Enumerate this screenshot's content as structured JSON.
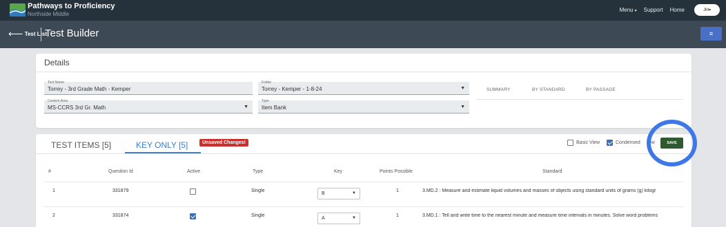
{
  "app": {
    "name": "Pathways to Proficiency",
    "school": "Northside Middle"
  },
  "topnav": {
    "menu": "Menu",
    "support": "Support",
    "home": "Home",
    "user_initials": "JM"
  },
  "subheader": {
    "back_label": "Test List",
    "title": "Test Builder",
    "menu_icon": "hamburger-icon"
  },
  "details": {
    "title": "Details",
    "test_name": {
      "label": "Test Name",
      "value": "Torrey - 3rd Grade Math - Kemper"
    },
    "folder": {
      "label": "Folder",
      "value": "Torrey - Kemper - 1-8-24"
    },
    "content_area": {
      "label": "Content Area",
      "value": "MS-CCRS 3rd Gr. Math"
    },
    "type": {
      "label": "Type",
      "value": "Item Bank"
    },
    "summary_tabs": [
      "SUMMARY",
      "BY STANDARD",
      "BY PASSAGE"
    ]
  },
  "tabs": {
    "test_items": "TEST ITEMS [5]",
    "key_only": "KEY ONLY [5]",
    "active": "key_only",
    "unsaved_badge": "Unsaved Changes!"
  },
  "view_options": {
    "basic_view": {
      "label": "Basic View",
      "checked": false
    },
    "condensed_view": {
      "label": "Condensed",
      "label_tail": "ew",
      "checked": true
    }
  },
  "save_label": "SAVE",
  "colors": {
    "topbar": "#25313b",
    "subbar": "#3d4a55",
    "accent": "#3d7ccf",
    "save": "#2f5a2f",
    "unsaved": "#c9302c",
    "highlight_ring": "#3d78e6"
  },
  "table": {
    "columns": [
      "#",
      "Question Id",
      "Active",
      "Type",
      "Key",
      "Points Possible",
      "Standard"
    ],
    "rows": [
      {
        "num": "1",
        "question_id": "331879",
        "active": false,
        "type": "Single",
        "key": "B",
        "points": "1",
        "standard": "3.MD.2 : Measure and estimate liquid volumes and masses of objects using standard units of grams (g) kilogr"
      },
      {
        "num": "2",
        "question_id": "331874",
        "active": true,
        "type": "Single",
        "key": "A",
        "points": "1",
        "standard": "3.MD.1 : Tell and write time to the nearest minute and measure time intervals in minutes. Solve word problems"
      }
    ]
  }
}
